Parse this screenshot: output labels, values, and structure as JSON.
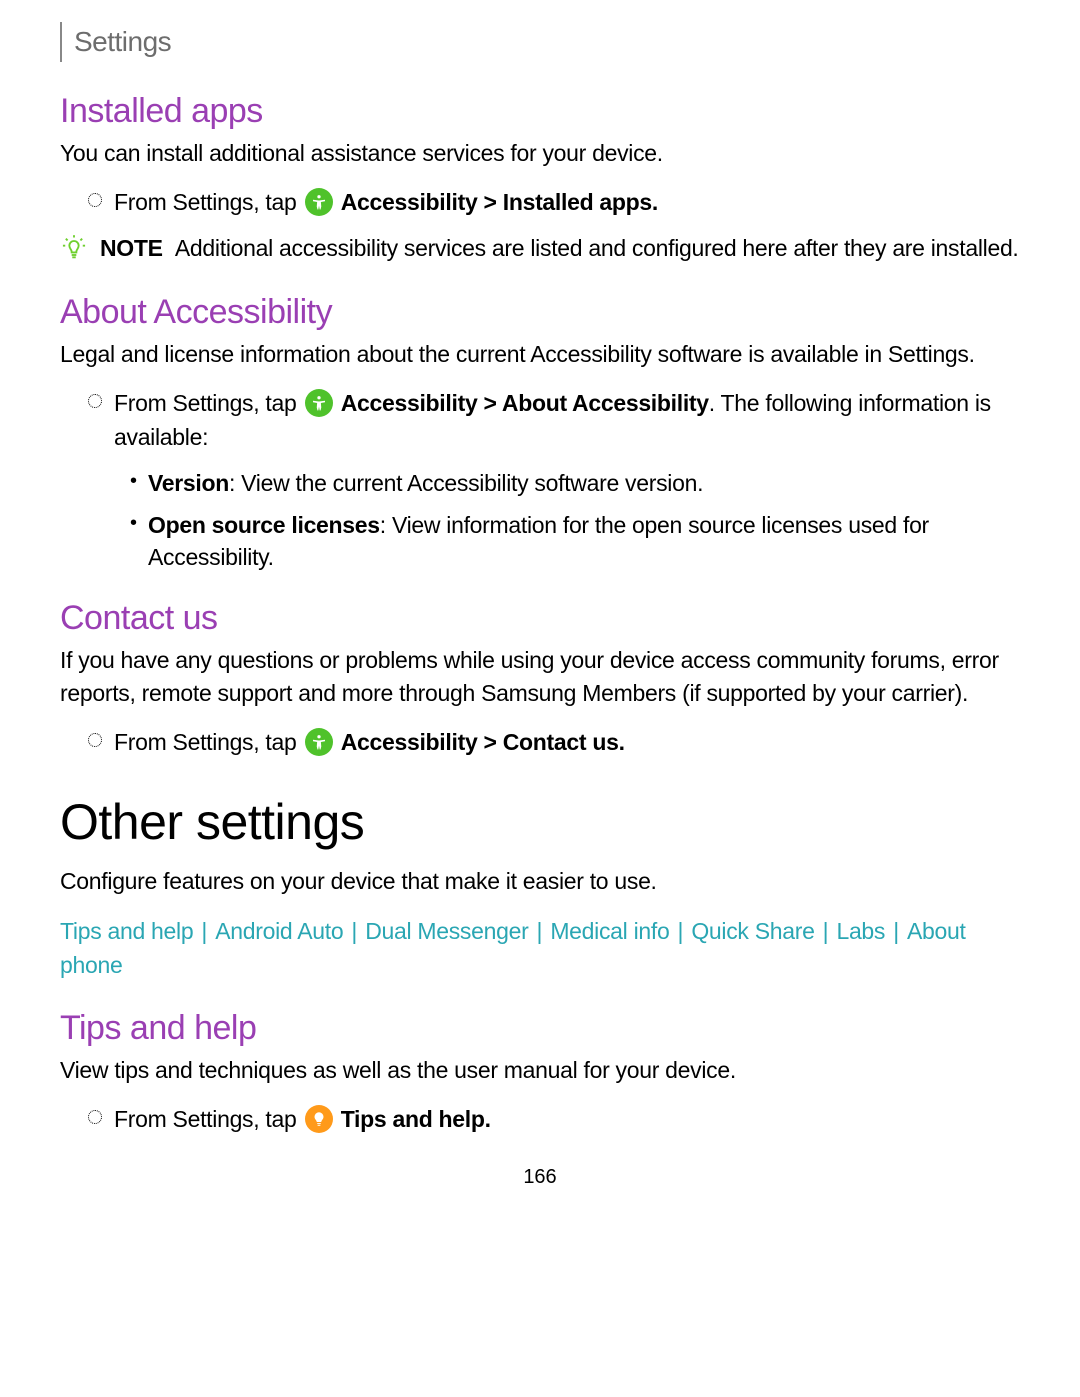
{
  "header": {
    "title": "Settings"
  },
  "sections": {
    "installed_apps": {
      "heading": "Installed apps",
      "body": "You can install additional assistance services for your device.",
      "step_prefix": "From Settings, tap",
      "step_path": "Accessibility > Installed apps",
      "note_label": "NOTE",
      "note_text": "Additional accessibility services are listed and configured here after they are installed."
    },
    "about": {
      "heading": "About Accessibility",
      "body": "Legal and license information about the current Accessibility software is available in Settings.",
      "step_prefix": "From Settings, tap",
      "step_path": "Accessibility > About Accessibility",
      "step_suffix": ". The following information is available:",
      "items": [
        {
          "label": "Version",
          "desc": ": View the current Accessibility software version."
        },
        {
          "label": "Open source licenses",
          "desc": ": View information for the open source licenses used for Accessibility."
        }
      ]
    },
    "contact": {
      "heading": "Contact us",
      "body": "If you have any questions or problems while using your device access community forums, error reports, remote support and more through Samsung Members (if supported by your carrier).",
      "step_prefix": "From Settings, tap",
      "step_path": "Accessibility > Contact us"
    },
    "other": {
      "heading": "Other settings",
      "body": "Configure features on your device that make it easier to use.",
      "links": [
        "Tips and help",
        "Android Auto",
        "Dual Messenger",
        "Medical info",
        "Quick Share",
        "Labs",
        "About phone"
      ]
    },
    "tips": {
      "heading": "Tips and help",
      "body": "View tips and techniques as well as the user manual for your device.",
      "step_prefix": "From Settings, tap",
      "step_path": "Tips and help"
    }
  },
  "page_number": "166"
}
